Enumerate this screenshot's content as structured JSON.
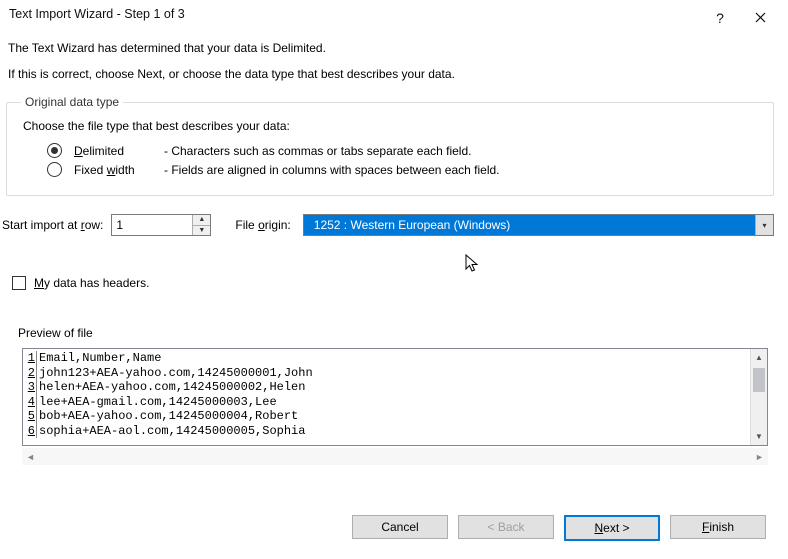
{
  "titlebar": {
    "title": "Text Import Wizard - Step 1 of 3"
  },
  "intro": {
    "line1": "The Text Wizard has determined that your data is Delimited.",
    "line2": "If this is correct, choose Next, or choose the data type that best describes your data."
  },
  "group": {
    "legend": "Original data type",
    "desc": "Choose the file type that best describes your data:",
    "options": [
      {
        "label_u": "D",
        "label_rest": "elimited",
        "desc": "- Characters such as commas or tabs separate each field.",
        "selected": true
      },
      {
        "label_pre": "Fixed ",
        "label_u": "w",
        "label_rest": "idth",
        "desc": "- Fields are aligned in columns with spaces between each field.",
        "selected": false
      }
    ]
  },
  "import_row": {
    "label_pre": "Start import at ",
    "label_u": "r",
    "label_post": "ow:",
    "value": "1",
    "origin_label_pre": "File ",
    "origin_label_u": "o",
    "origin_label_post": "rigin:",
    "origin_value": "1252 : Western European (Windows)"
  },
  "headers_chk": {
    "label_u": "M",
    "label_rest": "y data has headers."
  },
  "preview": {
    "label": "Preview of file",
    "path": " ",
    "lines": [
      "Email,Number,Name",
      "john123+AEA-yahoo.com,14245000001,John",
      "helen+AEA-yahoo.com,14245000002,Helen",
      "lee+AEA-gmail.com,14245000003,Lee",
      "bob+AEA-yahoo.com,14245000004,Robert",
      "sophia+AEA-aol.com,14245000005,Sophia"
    ]
  },
  "footer": {
    "cancel": "Cancel",
    "back": "< Back",
    "next": "Next >",
    "finish": "Finish"
  }
}
